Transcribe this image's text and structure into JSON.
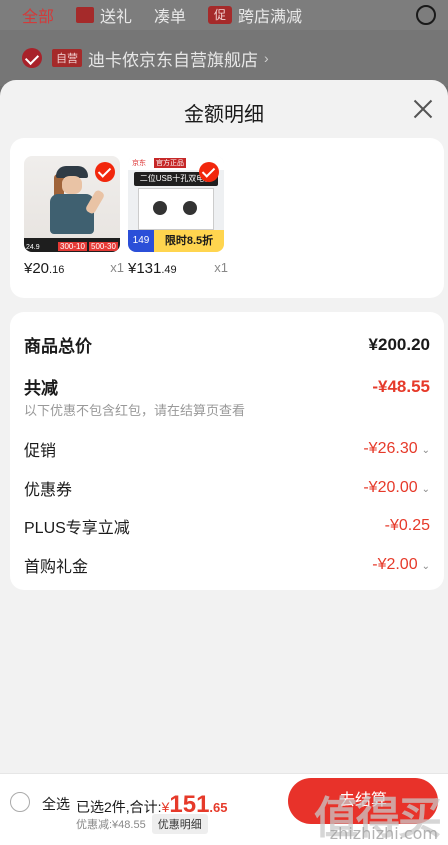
{
  "background": {
    "tabs": [
      "全部",
      "送礼",
      "凑单",
      "跨店满减"
    ],
    "promo_badge": "促",
    "store_badge": "自营",
    "store_name": "迪卡侬京东自营旗舰店",
    "store_arrow": "›"
  },
  "sheet": {
    "title": "金额明细",
    "products": [
      {
        "price_int": "¥20",
        "price_dec": ".16",
        "qty": "x1",
        "badges": [
          "24.9",
          "300-10",
          "500-30"
        ]
      },
      {
        "price_int": "¥131",
        "price_dec": ".49",
        "qty": "x1",
        "badges": [
          "京东",
          "官方正品",
          "二位USB十孔双电源",
          "149",
          "限时8.5折"
        ]
      }
    ],
    "summary": {
      "total_label": "商品总价",
      "total_value": "¥200.20",
      "discount_label": "共减",
      "discount_value": "-¥48.55",
      "note": "以下优惠不包含红包，请在结算页查看",
      "items": [
        {
          "label": "促销",
          "value": "-¥26.30",
          "chevron": true
        },
        {
          "label": "优惠券",
          "value": "-¥20.00",
          "chevron": true
        },
        {
          "label": "PLUS专享立减",
          "value": "-¥0.25",
          "chevron": false
        },
        {
          "label": "首购礼金",
          "value": "-¥2.00",
          "chevron": true
        }
      ]
    }
  },
  "bottom": {
    "select_all": "全选",
    "selected_count": "已选2件,合计:",
    "total_symbol": "¥",
    "total_int": "151",
    "total_dec": ".65",
    "discount_text": "优惠减:¥48.55",
    "detail_button": "优惠明细",
    "checkout_label": "去结算",
    "watermark": "值得买",
    "watermark_url": "zhizhizhi.com"
  },
  "colors": {
    "accent": "#e63a2a",
    "brand_red": "#f2270c"
  }
}
